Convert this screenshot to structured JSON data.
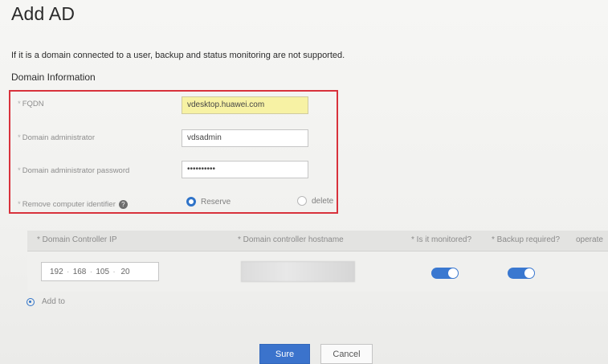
{
  "page": {
    "title": "Add AD",
    "notice": "If it is a domain connected to a user, backup and status monitoring are not supported."
  },
  "domain_info": {
    "section_title": "Domain Information",
    "required_marker": "*",
    "fqdn": {
      "label": "FQDN",
      "value": "vdesktop.huawei.com"
    },
    "admin": {
      "label": "Domain administrator",
      "value": "vdsadmin"
    },
    "password": {
      "label": "Domain administrator password",
      "value": "••••••••••"
    },
    "computer_identifier": {
      "label": "Remove computer identifier",
      "help_icon": "?",
      "options": [
        {
          "label": "Reserve",
          "selected": true
        },
        {
          "label": "delete",
          "selected": false
        }
      ]
    }
  },
  "controllers_table": {
    "columns": [
      "* Domain Controller IP",
      "* Domain controller hostname",
      "* Is it monitored?",
      "* Backup required?",
      "operate"
    ],
    "rows": [
      {
        "ip": [
          "192",
          "168",
          "105",
          "20"
        ],
        "ip_separator": "·",
        "hostname": "",
        "monitored": true,
        "backup": true
      }
    ],
    "add_label": "Add to"
  },
  "footer": {
    "confirm_label": "Sure",
    "cancel_label": "Cancel"
  },
  "colors": {
    "accent": "#3b73cc",
    "highlight_box": "#d8323c",
    "autofill_yellow": "#f7f2a4"
  }
}
